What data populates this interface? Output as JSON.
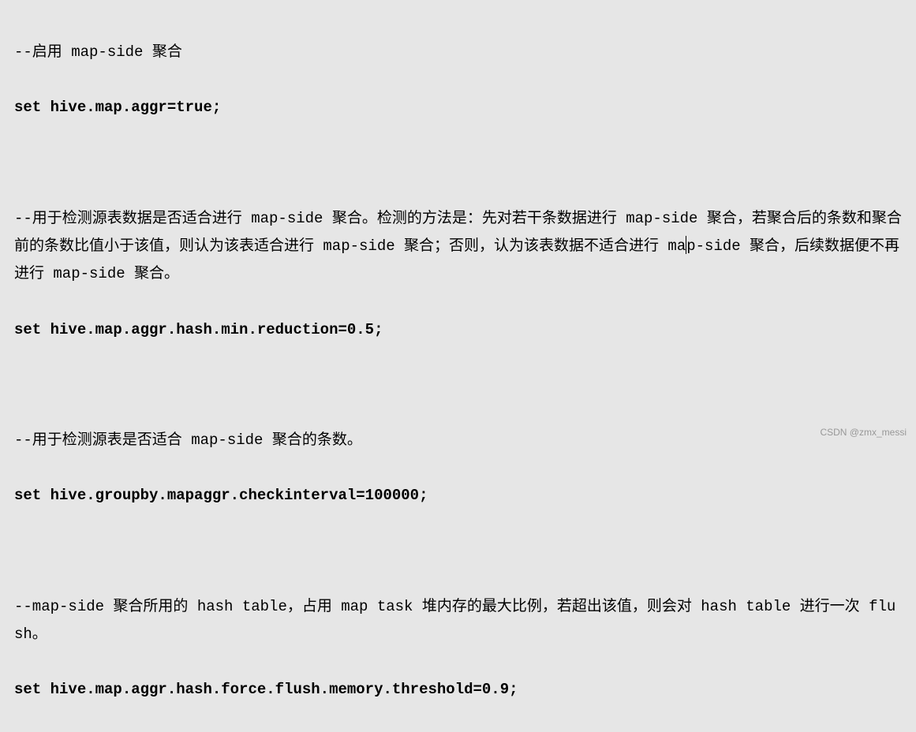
{
  "lines": {
    "comment1": "--启用 map-side 聚合",
    "config1": "set hive.map.aggr=true;",
    "comment2_part1": "--用于检测源表数据是否适合进行 map-side 聚合。检测的方法是：先对若干条数据进行 map-side 聚合，若聚合后的条数和聚合前的条数比值小于该值，则认为该表适合进行 map-side 聚合；否则，认为该表数据不适合进行 ma",
    "comment2_cursor_char": "p",
    "comment2_part2": "-side 聚合，后续数据便不再进行 map-side 聚合。",
    "config2": "set hive.map.aggr.hash.min.reduction=0.5;",
    "comment3": "--用于检测源表是否适合 map-side 聚合的条数。",
    "config3": "set hive.groupby.mapaggr.checkinterval=100000;",
    "comment4": "--map-side 聚合所用的 hash table，占用 map task 堆内存的最大比例，若超出该值，则会对 hash table 进行一次 flush。",
    "config4": "set hive.map.aggr.hash.force.flush.memory.threshold=0.9;"
  },
  "watermark": "CSDN @zmx_messi"
}
